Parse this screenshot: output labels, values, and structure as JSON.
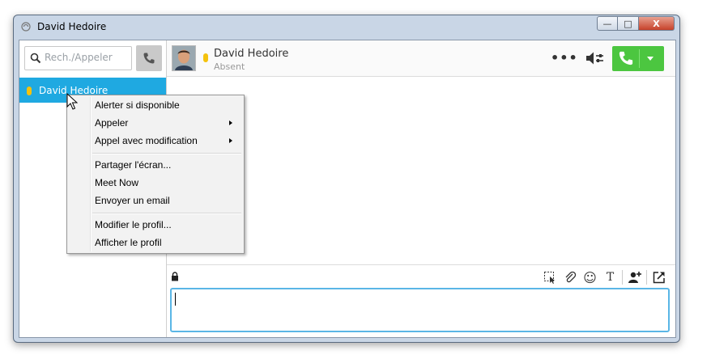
{
  "window": {
    "title": "David Hedoire",
    "minimize": "—",
    "maximize": "□",
    "close": "X"
  },
  "search": {
    "placeholder": "Rech./Appeler"
  },
  "contacts": [
    {
      "name": "David Hedoire",
      "status_color": "#f4c20d"
    }
  ],
  "header": {
    "name": "David Hedoire",
    "status": "Absent",
    "more": "•••"
  },
  "colors": {
    "accent": "#1fa9e1",
    "call_green": "#4cc640",
    "away_yellow": "#f4c20d"
  },
  "toolbar_icons": [
    "lock-icon",
    "screenshot-icon",
    "attach-icon",
    "emoji-icon",
    "text-format-icon",
    "add-contact-icon",
    "popout-icon"
  ],
  "toolbar_labels": {
    "text_format": "T",
    "emoji": "☺"
  },
  "context_menu": {
    "items": [
      {
        "label": "Alerter si disponible"
      },
      {
        "label": "Appeler",
        "submenu": true
      },
      {
        "label": "Appel avec modification",
        "submenu": true
      },
      {
        "label": "Partager l'écran..."
      },
      {
        "label": "Meet Now"
      },
      {
        "label": "Envoyer un email"
      },
      {
        "label": "Modifier le profil..."
      },
      {
        "label": "Afficher le profil"
      }
    ]
  }
}
